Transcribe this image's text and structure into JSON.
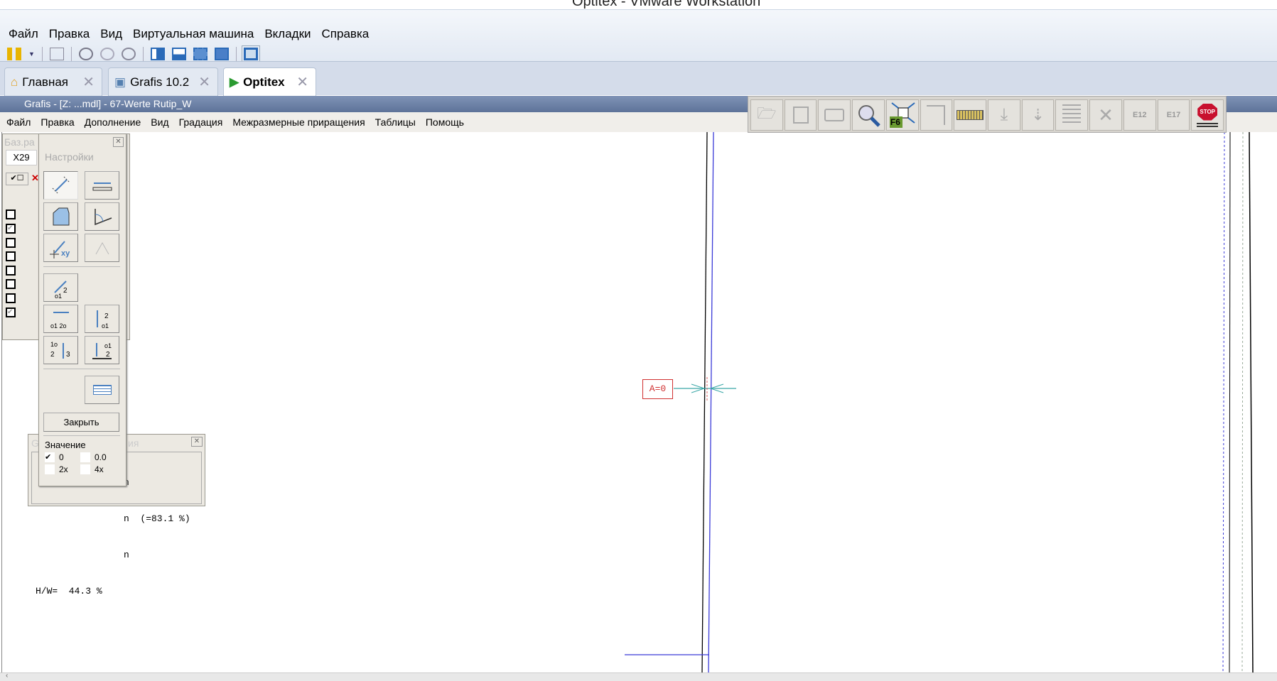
{
  "window": {
    "title": "Optitex - VMware Workstation"
  },
  "vm_menu": [
    "Файл",
    "Правка",
    "Вид",
    "Виртуальная машина",
    "Вкладки",
    "Справка"
  ],
  "tabs": [
    {
      "label": "Главная",
      "icon": "home-icon"
    },
    {
      "label": "Grafis 10.2",
      "icon": "vm-icon"
    },
    {
      "label": "Optitex",
      "icon": "vm-running-icon",
      "active": true
    }
  ],
  "grafis": {
    "title": "Grafis - [Z: ...mdl] - 67-Werte Rutip_W",
    "menu": [
      "Файл",
      "Правка",
      "Дополнение",
      "Вид",
      "Градация",
      "Межразмерные приращения",
      "Таблицы",
      "Помощь"
    ]
  },
  "right_toolbar": [
    "open-icon",
    "save-icon",
    "print-icon",
    "zoom-icon",
    "f6-fit-icon",
    "piece-icon",
    "measure-tape-icon",
    "place-down-icon",
    "place-line-icon",
    "grade-table-icon",
    "x-table-icon",
    "e12-icon",
    "e17-icon",
    "stop-icon"
  ],
  "f6_label": "F6",
  "stop_label": "STOP",
  "base_panel": {
    "title": "Баз.ра",
    "field": "X29"
  },
  "settings_panel": {
    "title": "Настройки",
    "close_label": "Закрыть",
    "value_label": "Значение",
    "options": [
      {
        "label": "0",
        "checked": true
      },
      {
        "label": "0.0",
        "checked": false
      },
      {
        "label": "2x",
        "checked": false
      },
      {
        "label": "4x",
        "checked": false
      }
    ]
  },
  "info_panel": {
    "title_left": "G",
    "title_right": "ия",
    "line1": "n",
    "line2": "n  (=83.1 %)",
    "line3": "n",
    "hw": "H/W=  44.3 %"
  },
  "canvas": {
    "annotation": "A=0"
  },
  "colors": {
    "line_blue": "#3a3ad8",
    "annotation_red": "#d03030",
    "arrow_teal": "#3aa7a7"
  }
}
